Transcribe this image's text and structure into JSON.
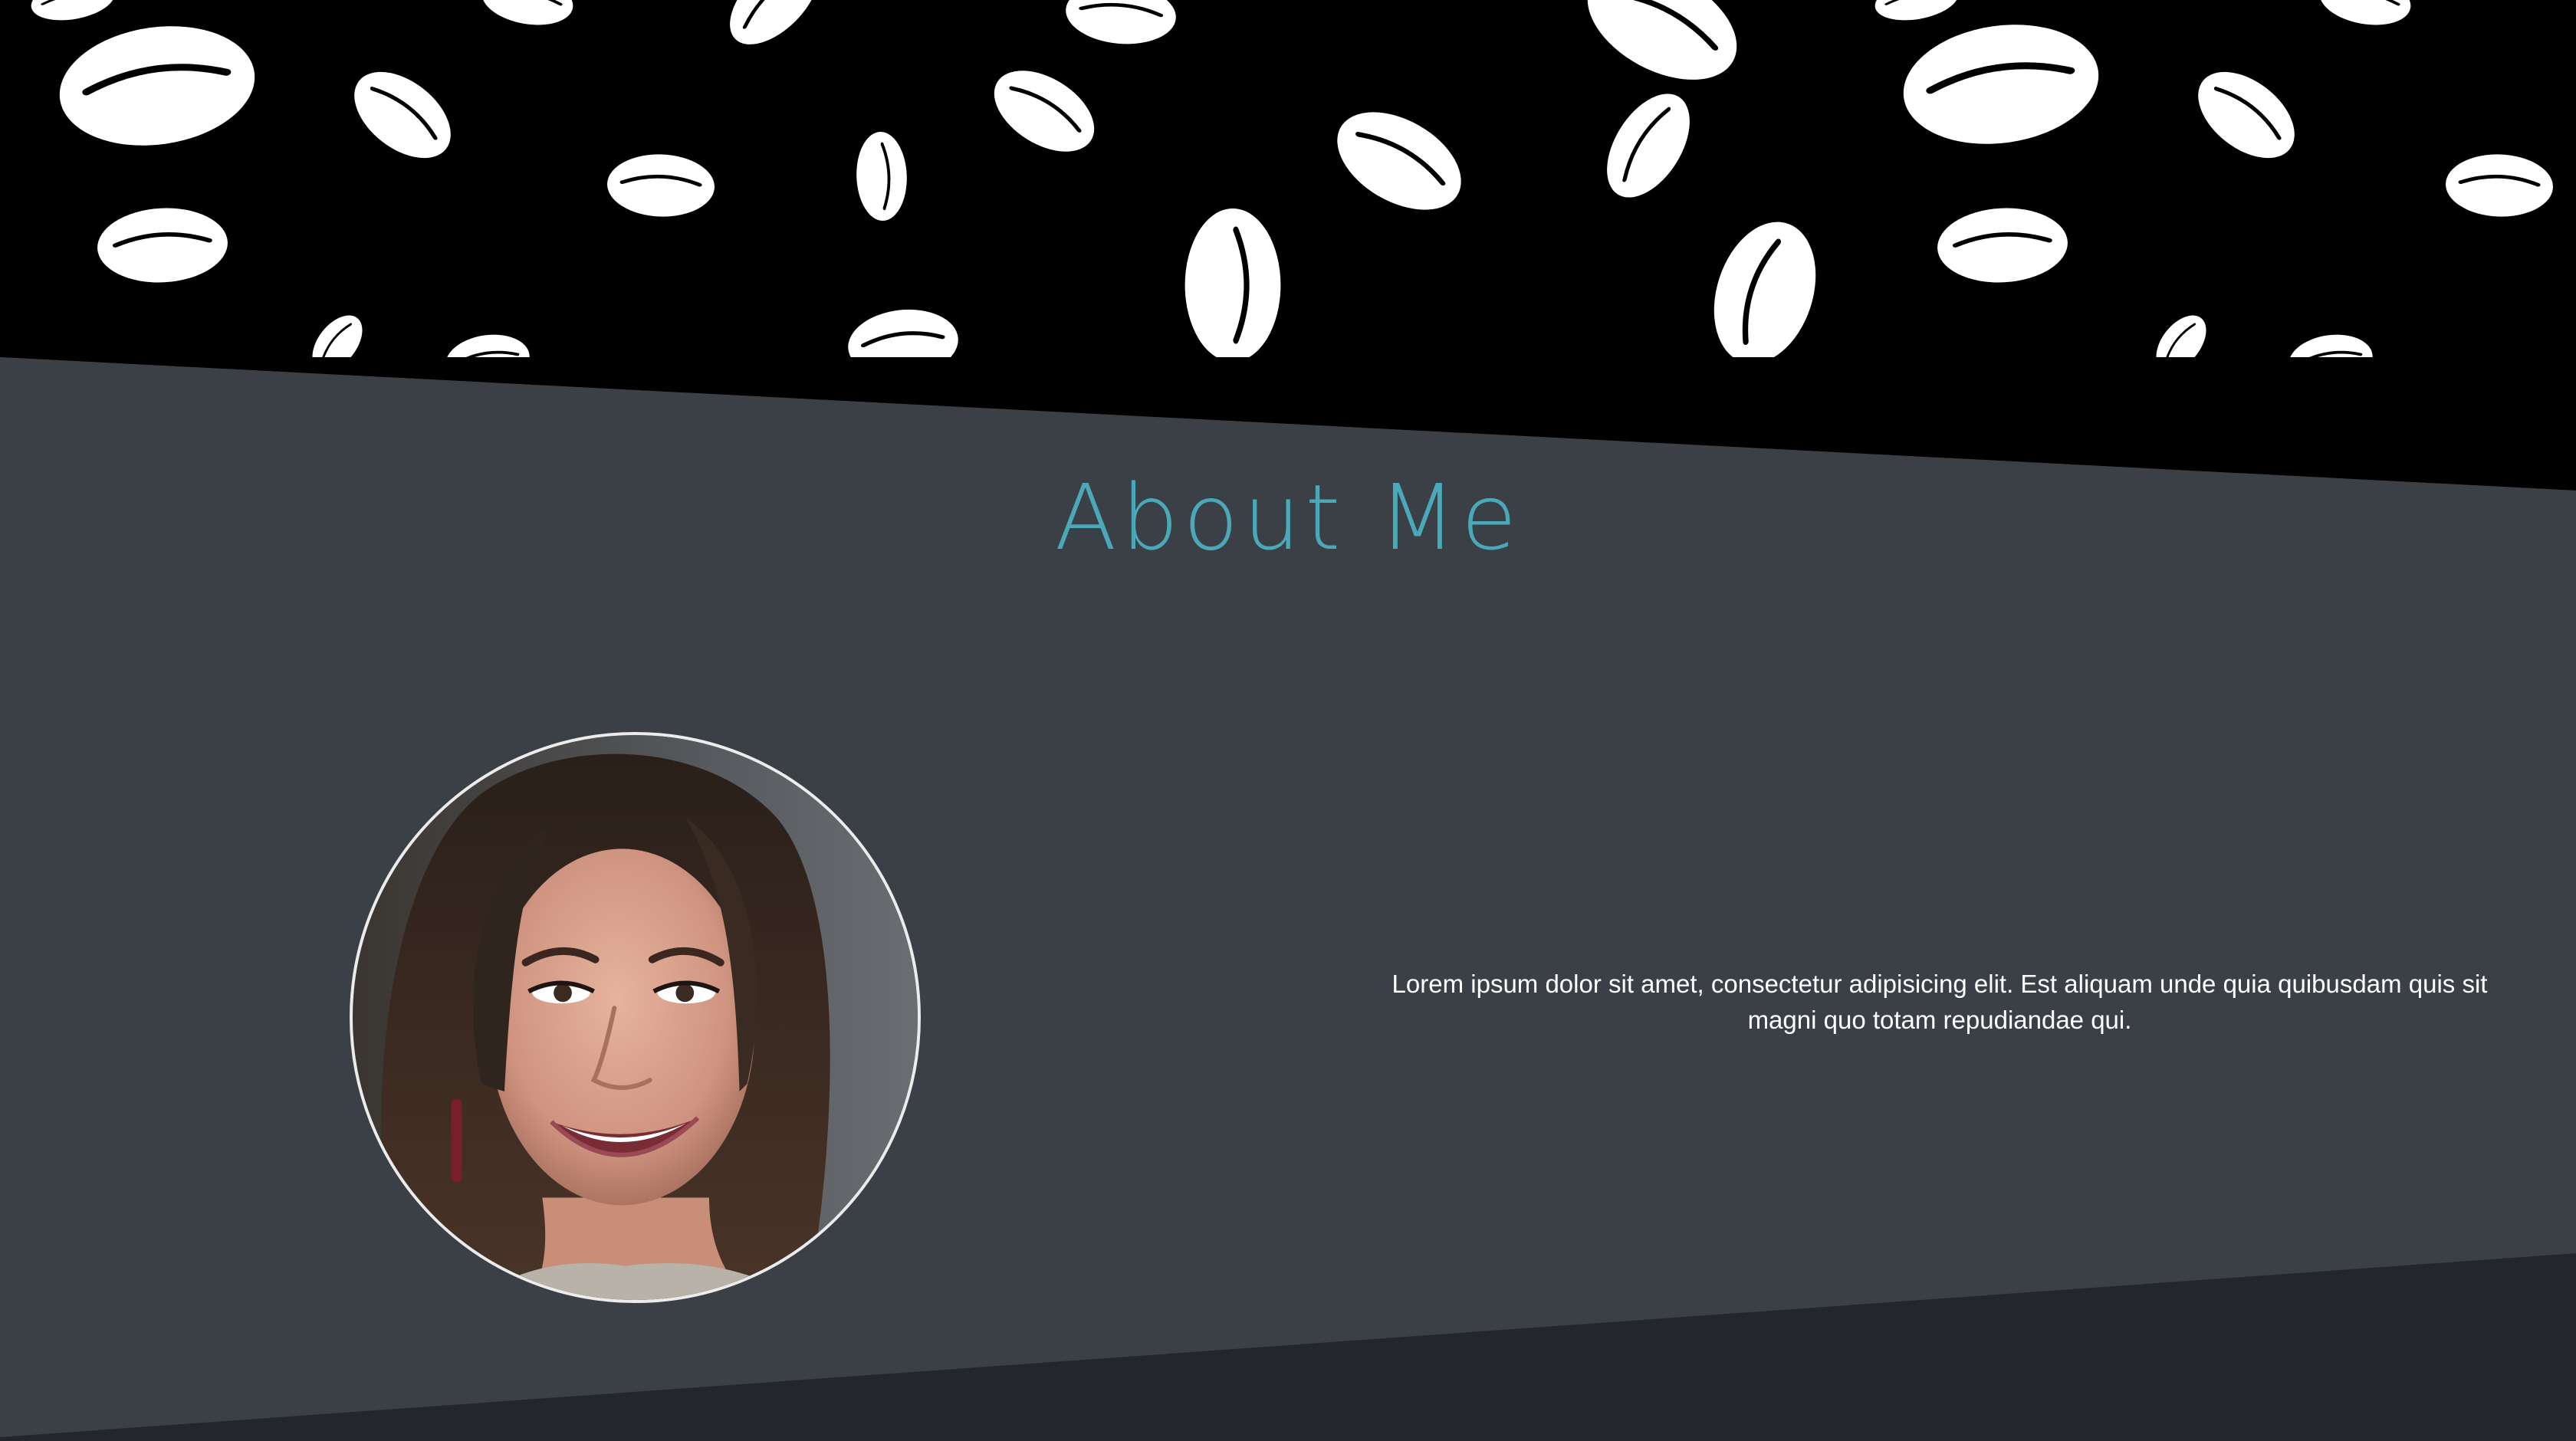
{
  "about": {
    "title": "About Me",
    "body": "Lorem ipsum dolor sit amet, consectetur adipisicing elit. Est aliquam unde quia quibusdam quis sit magni quo totam repudiandae qui."
  },
  "colors": {
    "section_bg": "#3b3f46",
    "hero_bg": "#000000",
    "footer_bg": "#23262d",
    "title_accent": "#4aa8b8",
    "text": "#ffffff"
  },
  "icons": {
    "hero_pattern": "coffee-bean-pattern",
    "portrait": "profile-photo"
  }
}
